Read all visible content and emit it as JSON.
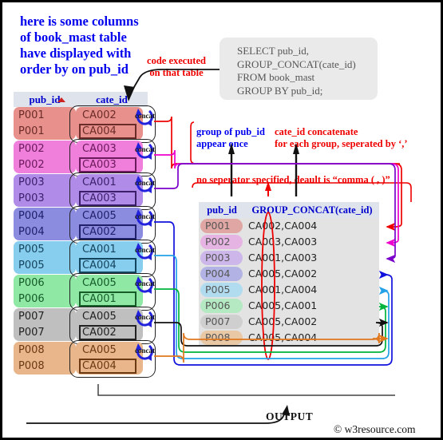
{
  "intro_note": "here is some columns\nof book_mast table\nhave displayed with\norder by on pub_id",
  "annotations": {
    "code_executed": "code executed\non that table",
    "group_once": "group of pub_id\nappear once",
    "cate_concat": "cate_id concatenate\nfor each group, seperated by ‘,’",
    "separator": "no seperator specified, deault is “comma ( , )”",
    "output_label": "OUTPUT",
    "copyright": "© w3resource.com"
  },
  "sql": {
    "code": "SELECT pub_id,\nGROUP_CONCAT(cate_id)\nFROM book_mast\nGROUP BY pub_id;"
  },
  "source_table": {
    "name": "book_mast",
    "headers": [
      "pub_id",
      "cate_id"
    ],
    "sorted_by": "pub_id",
    "sort_dir": "asc",
    "concat_label": "concat",
    "groups": [
      {
        "pub_id": "P001",
        "cate_ids": [
          "CA002",
          "CA004"
        ],
        "color": "#e8918c",
        "color_dark": "#df7f79",
        "text": "#6b2b28",
        "line": "#ee0000"
      },
      {
        "pub_id": "P002",
        "cate_ids": [
          "CA003",
          "CA003"
        ],
        "color": "#f07edb",
        "color_dark": "#ec68d2",
        "text": "#6b1a5c",
        "line": "#ee00cc"
      },
      {
        "pub_id": "P003",
        "cate_ids": [
          "CA001",
          "CA003"
        ],
        "color": "#b08ce8",
        "color_dark": "#a277e4",
        "text": "#3b1f6b",
        "line": "#7b00cc"
      },
      {
        "pub_id": "P004",
        "cate_ids": [
          "CA005",
          "CA002"
        ],
        "color": "#8b8ce0",
        "color_dark": "#7a7bda",
        "text": "#20206b",
        "line": "#1111dd"
      },
      {
        "pub_id": "P005",
        "cate_ids": [
          "CA001",
          "CA004"
        ],
        "color": "#87cdee",
        "color_dark": "#6fc3ea",
        "text": "#14455e",
        "line": "#22a0e8"
      },
      {
        "pub_id": "P006",
        "cate_ids": [
          "CA005",
          "CA001"
        ],
        "color": "#8fe8a4",
        "color_dark": "#79e291",
        "text": "#155c29",
        "line": "#00b33c"
      },
      {
        "pub_id": "P007",
        "cate_ids": [
          "CA005",
          "CA002"
        ],
        "color": "#bfbfbf",
        "color_dark": "#adadad",
        "text": "#222222",
        "line": "#111111"
      },
      {
        "pub_id": "P008",
        "cate_ids": [
          "CA005",
          "CA004"
        ],
        "color": "#e8b68a",
        "color_dark": "#e2a772",
        "text": "#6b3a12",
        "line": "#e07820"
      }
    ]
  },
  "output_table": {
    "headers": [
      "pub_id",
      "GROUP_CONCAT(cate_id)"
    ],
    "rows": [
      {
        "pub_id": "P001",
        "value": "CA002,CA004",
        "color": "#e0a6a3",
        "arrow": "#ee0000"
      },
      {
        "pub_id": "P002",
        "value": "CA003,CA003",
        "color": "#e6b4e2",
        "arrow": "#ee00cc"
      },
      {
        "pub_id": "P003",
        "value": "CA001,CA003",
        "color": "#cdb6ea",
        "arrow": "#7b00cc"
      },
      {
        "pub_id": "P004",
        "value": "CA005,CA002",
        "color": "#b2b3e4",
        "arrow": "#1111dd"
      },
      {
        "pub_id": "P005",
        "value": "CA001,CA004",
        "color": "#b1dcf0",
        "arrow": "#22a0e8"
      },
      {
        "pub_id": "P006",
        "value": "CA005,CA001",
        "color": "#b4e9c2",
        "arrow": "#00b33c"
      },
      {
        "pub_id": "P007",
        "value": "CA005,CA002",
        "color": "#cfcfcf",
        "arrow": "#111111"
      },
      {
        "pub_id": "P008",
        "value": "CA005,CA004",
        "color": "#e8c8a5",
        "arrow": "#e07820"
      }
    ]
  },
  "icons": {
    "concat_icon": "circular-arrow-icon",
    "sort_icon": "sort-asc-caret-icon",
    "separator_marker": "red-ellipse-highlight"
  }
}
